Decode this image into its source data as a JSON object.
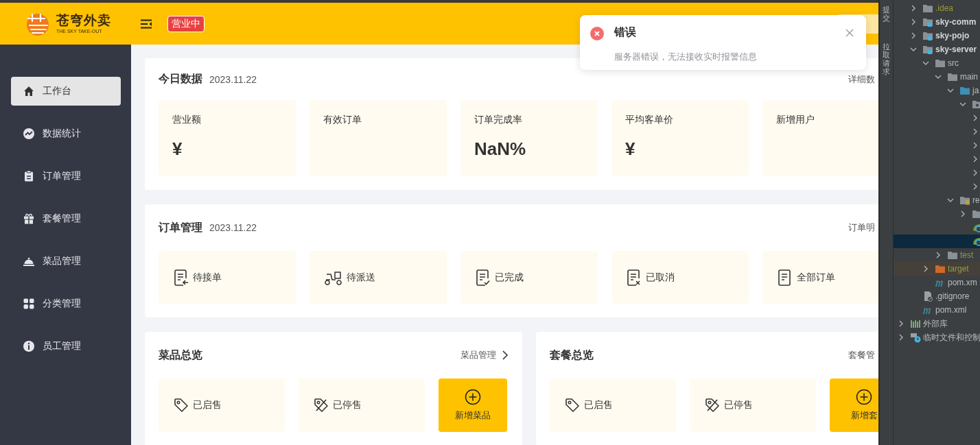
{
  "header": {
    "logo_title": "苍穹外卖",
    "logo_subtitle": "THE SKY TAKE-OUT",
    "status_badge": "营业中"
  },
  "sidebar": {
    "items": [
      {
        "label": "工作台",
        "selected": true
      },
      {
        "label": "数据统计",
        "selected": false
      },
      {
        "label": "订单管理",
        "selected": false
      },
      {
        "label": "套餐管理",
        "selected": false
      },
      {
        "label": "菜品管理",
        "selected": false
      },
      {
        "label": "分类管理",
        "selected": false
      },
      {
        "label": "员工管理",
        "selected": false
      }
    ]
  },
  "today_data": {
    "title": "今日数据",
    "date": "2023.11.22",
    "link": "详细数",
    "stats": [
      {
        "label": "营业额",
        "value": "¥"
      },
      {
        "label": "有效订单"
      },
      {
        "label": "订单完成率",
        "value": "NaN%"
      },
      {
        "label": "平均客单价",
        "value": "¥"
      },
      {
        "label": "新增用户"
      }
    ]
  },
  "order_management": {
    "title": "订单管理",
    "date": "2023.11.22",
    "link": "订单明",
    "items": [
      {
        "label": "待接单"
      },
      {
        "label": "待派送"
      },
      {
        "label": "已完成"
      },
      {
        "label": "已取消"
      },
      {
        "label": "全部订单"
      }
    ]
  },
  "overviews": [
    {
      "title": "菜品总览",
      "link": "菜品管理",
      "chevron": true,
      "items": [
        {
          "label": "已启售"
        },
        {
          "label": "已停售"
        }
      ],
      "add_button": "新增菜品"
    },
    {
      "title": "套餐总览",
      "link": "套餐管",
      "chevron": false,
      "items": [
        {
          "label": "已启售"
        },
        {
          "label": "已停售"
        }
      ],
      "add_button": "新增套"
    }
  ],
  "notification": {
    "title": "错误",
    "message": "服务器错误，无法接收实时报警信息"
  },
  "ide": {
    "tool_tabs": [
      {
        "label": "提交"
      },
      {
        "label": "拉取请求"
      }
    ],
    "project_items": [
      {
        "label": ".idea",
        "kind": "ignored",
        "expanded": false,
        "selected": false
      },
      {
        "label": "sky-comm",
        "kind": "module",
        "expanded": false,
        "selected": false
      },
      {
        "label": "sky-pojo",
        "kind": "module",
        "expanded": false,
        "selected": false
      },
      {
        "label": "sky-server",
        "kind": "module",
        "expanded": true,
        "selected": false,
        "children": [
          {
            "label": "src",
            "kind": "folder",
            "expanded": true,
            "selected": false,
            "children": [
              {
                "label": "main",
                "kind": "folder",
                "expanded": true,
                "selected": false,
                "children": [
                  {
                    "label": "ja",
                    "kind": "source",
                    "expanded": true,
                    "selected": false,
                    "children": [
                      {
                        "kind": "package",
                        "expanded": true,
                        "selected": false,
                        "children": [
                          {
                            "expanded": false,
                            "selected": false
                          },
                          {
                            "expanded": false,
                            "selected": false
                          },
                          {
                            "expanded": false,
                            "selected": false
                          },
                          {
                            "expanded": false,
                            "selected": false
                          },
                          {
                            "expanded": false,
                            "selected": false
                          },
                          {
                            "expanded": false,
                            "selected": false
                          }
                        ]
                      }
                    ]
                  },
                  {
                    "label": "re",
                    "kind": "resources",
                    "expanded": true,
                    "selected": false,
                    "children": [
                      {
                        "kind": "folder",
                        "expanded": false,
                        "selected": false
                      },
                      {
                        "kind": "spring",
                        "selected": false
                      },
                      {
                        "kind": "spring",
                        "selected": true
                      }
                    ]
                  }
                ]
              },
              {
                "label": "test",
                "kind": "test",
                "expanded": false,
                "selected": false
              }
            ]
          },
          {
            "label": "target",
            "kind": "excluded",
            "expanded": false,
            "selected": false
          },
          {
            "label": "pom.xm",
            "kind": "maven",
            "selected": false
          }
        ]
      },
      {
        "label": ".gitignore",
        "kind": "gitignore",
        "selected": false
      },
      {
        "label": "pom.xml",
        "kind": "maven",
        "selected": false
      }
    ],
    "root_items": [
      {
        "label": "外部库",
        "kind": "library",
        "expanded": false,
        "selected": false
      },
      {
        "label": "临时文件和控制",
        "kind": "scratch",
        "expanded": false,
        "selected": false
      }
    ]
  }
}
